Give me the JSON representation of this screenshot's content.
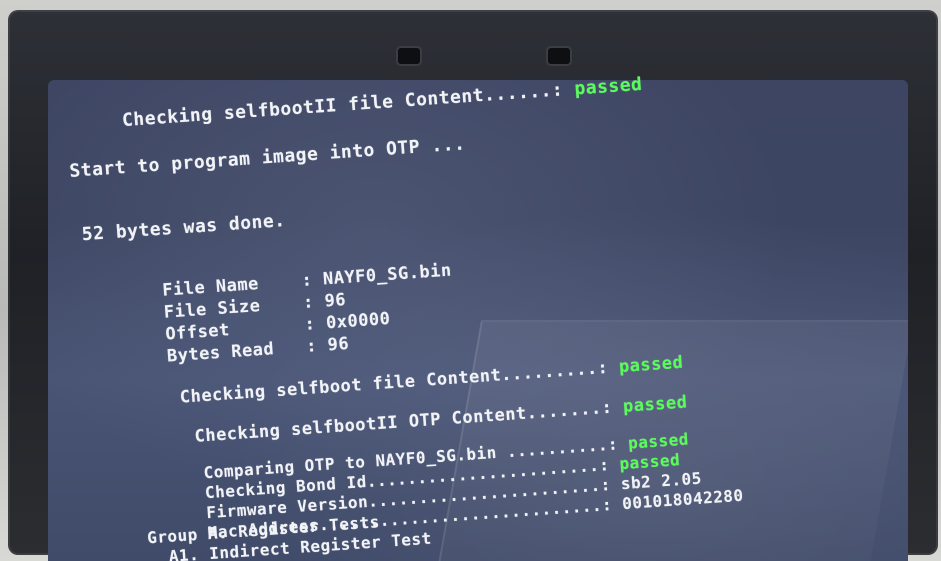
{
  "terminal": {
    "checking_selfboot2_file": {
      "label": "Checking selfbootII file Content......: ",
      "status": "passed"
    },
    "start_program": "Start to program image into OTP ...",
    "bytes_done": "52 bytes was done.",
    "file_info": [
      {
        "label": "File Name    ",
        "value": ": NAYF0_SG.bin"
      },
      {
        "label": "File Size    ",
        "value": ": 96"
      },
      {
        "label": "Offset       ",
        "value": ": 0x0000"
      },
      {
        "label": "Bytes Read   ",
        "value": ": 96"
      }
    ],
    "checking_selfboot_file": {
      "label": "Checking selfboot file Content.........: ",
      "status": "passed"
    },
    "checking_selfboot2_otp": {
      "label": "Checking selfbootII OTP Content.......: ",
      "status": "passed"
    },
    "comparing_otp": {
      "label": "Comparing OTP to NAYF0_SG.bin ..........: ",
      "status": "passed"
    },
    "checking_bond": {
      "label": "Checking Bond Id.......................: ",
      "status": "passed"
    },
    "firmware_version": {
      "label": "Firmware Version.......................: ",
      "value": "sb2 2.05"
    },
    "mac_address": {
      "label": "Mac Address............................: ",
      "value": "001018042280"
    },
    "group_a": "Group A. Register Tests",
    "a1": "  A1. Indirect Register Test"
  },
  "colors": {
    "pass_text": "#55ff55",
    "terminal_text": "#f1f3f7",
    "screen_bg": "#3f4a68"
  }
}
